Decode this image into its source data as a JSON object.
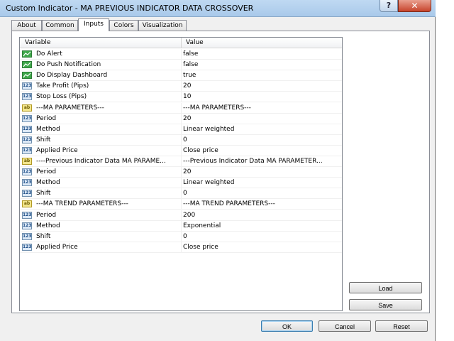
{
  "window": {
    "title": "Custom Indicator - MA PREVIOUS INDICATOR DATA CROSSOVER",
    "help_label": "?",
    "close_label": "✕"
  },
  "tabs": [
    {
      "label": "About"
    },
    {
      "label": "Common"
    },
    {
      "label": "Inputs"
    },
    {
      "label": "Colors"
    },
    {
      "label": "Visualization"
    }
  ],
  "active_tab": "Inputs",
  "grid": {
    "headers": {
      "variable": "Variable",
      "value": "Value"
    },
    "rows": [
      {
        "icon": "bool",
        "variable": "Do Alert",
        "value": "false"
      },
      {
        "icon": "bool",
        "variable": "Do Push Notification",
        "value": "false"
      },
      {
        "icon": "bool",
        "variable": "Do Display Dashboard",
        "value": "true"
      },
      {
        "icon": "num",
        "variable": "Take Profit (Pips)",
        "value": "20"
      },
      {
        "icon": "num",
        "variable": "Stop Loss (Pips)",
        "value": "10"
      },
      {
        "icon": "str",
        "variable": "---MA PARAMETERS---",
        "value": "---MA PARAMETERS---"
      },
      {
        "icon": "num",
        "variable": "Period",
        "value": "20"
      },
      {
        "icon": "num",
        "variable": "Method",
        "value": "Linear weighted"
      },
      {
        "icon": "num",
        "variable": "Shift",
        "value": "0"
      },
      {
        "icon": "num",
        "variable": "Applied Price",
        "value": "Close price"
      },
      {
        "icon": "str",
        "variable": "----Previous Indicator Data MA PARAME...",
        "value": "---Previous Indicator Data MA PARAMETER..."
      },
      {
        "icon": "num",
        "variable": "Period",
        "value": "20"
      },
      {
        "icon": "num",
        "variable": "Method",
        "value": "Linear weighted"
      },
      {
        "icon": "num",
        "variable": "Shift",
        "value": "0"
      },
      {
        "icon": "str",
        "variable": "---MA TREND PARAMETERS---",
        "value": "---MA TREND PARAMETERS---"
      },
      {
        "icon": "num",
        "variable": "Period",
        "value": "200"
      },
      {
        "icon": "num",
        "variable": "Method",
        "value": "Exponential"
      },
      {
        "icon": "num",
        "variable": "Shift",
        "value": "0"
      },
      {
        "icon": "num",
        "variable": "Applied Price",
        "value": "Close price"
      }
    ]
  },
  "icon_labels": {
    "num": "123",
    "str": "ab"
  },
  "buttons": {
    "load": "Load",
    "save": "Save",
    "ok": "OK",
    "cancel": "Cancel",
    "reset": "Reset"
  }
}
